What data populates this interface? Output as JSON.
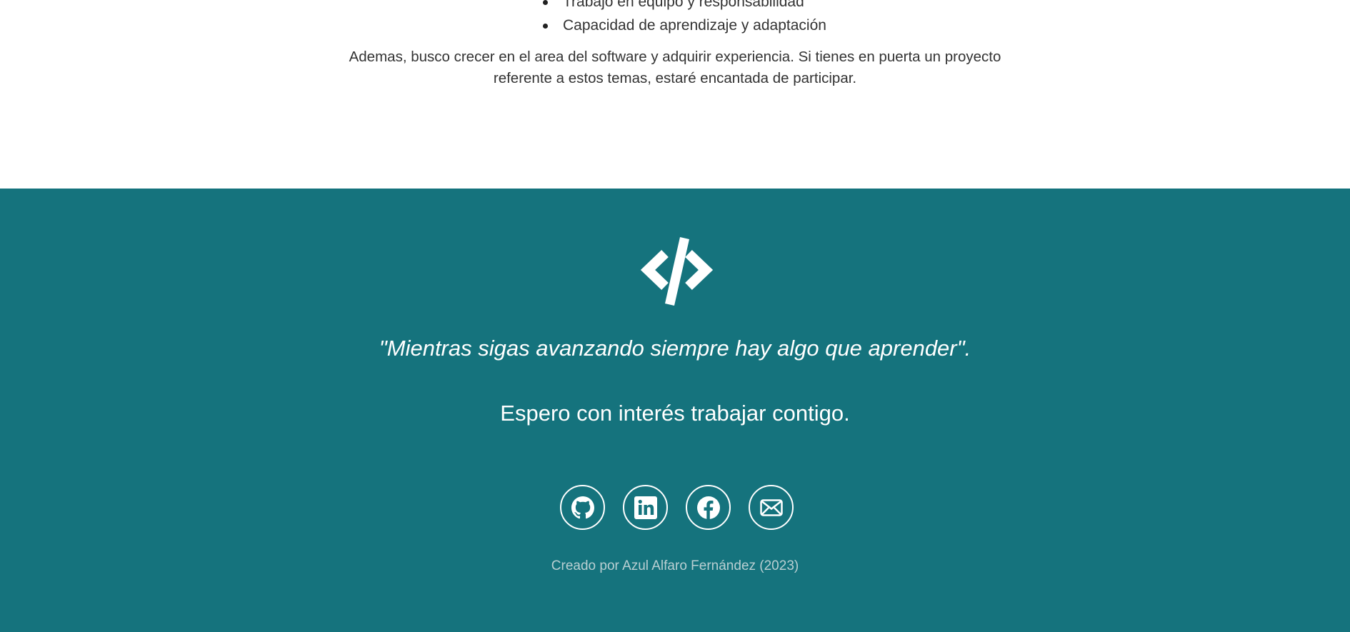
{
  "about": {
    "skills": [
      "Trabajo en equipo y responsabilidad",
      "Capacidad de aprendizaje y adaptación"
    ],
    "paragraph": "Ademas, busco crecer en el area del software y adquirir experiencia. Si tienes en puerta un proyecto referente a estos temas, estaré encantada de participar."
  },
  "footer": {
    "logo_icon": "code-icon",
    "quote": "\"Mientras sigas avanzando siempre hay algo que aprender\".",
    "closing": "Espero con interés trabajar contigo.",
    "social": [
      {
        "icon": "github-icon",
        "label": "GitHub"
      },
      {
        "icon": "linkedin-icon",
        "label": "LinkedIn"
      },
      {
        "icon": "facebook-icon",
        "label": "Facebook"
      },
      {
        "icon": "envelope-icon",
        "label": "Email"
      }
    ],
    "credit": "Creado por Azul Alfaro Fernández (2023)"
  },
  "colors": {
    "footer_background": "#15737d",
    "footer_text": "#ffffff",
    "credit_text": "#b9cfd2",
    "body_text": "#333333"
  }
}
